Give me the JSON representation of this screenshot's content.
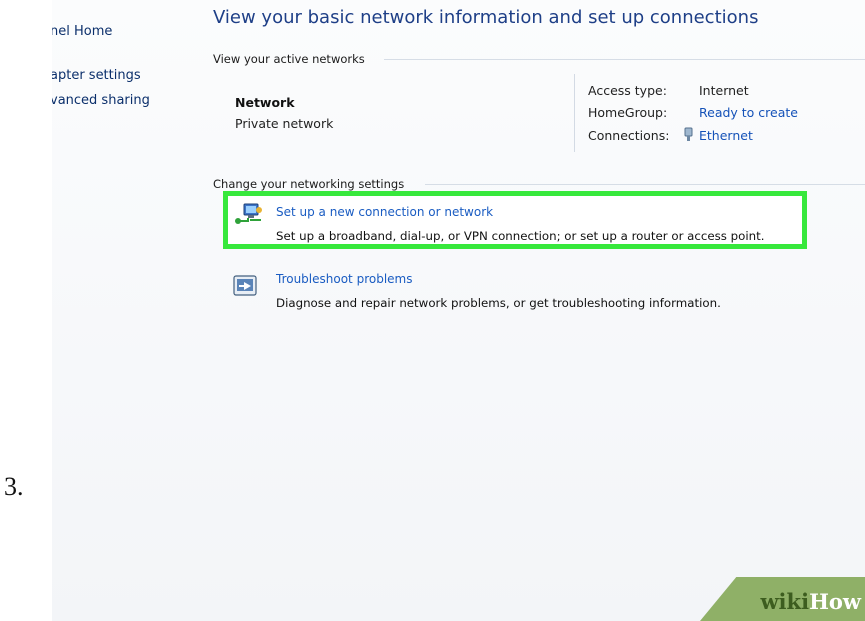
{
  "step_number": "3.",
  "sidebar": {
    "items": [
      {
        "label": "nel Home"
      },
      {
        "label": "apter settings"
      },
      {
        "label": "vanced sharing"
      }
    ]
  },
  "main": {
    "title": "View your basic network information and set up connections",
    "active_networks": {
      "label": "View your active networks",
      "network_name": "Network",
      "network_type": "Private network",
      "access_type_label": "Access type:",
      "access_type_value": "Internet",
      "homegroup_label": "HomeGroup:",
      "homegroup_value": "Ready to create",
      "connections_label": "Connections:",
      "connections_value": "Ethernet"
    },
    "change_settings": {
      "label": "Change your networking settings",
      "tasks": [
        {
          "link": "Set up a new connection or network",
          "description": "Set up a broadband, dial-up, or VPN connection; or set up a router or access point.",
          "icon": "network-setup-icon"
        },
        {
          "link": "Troubleshoot problems",
          "description": "Diagnose and repair network problems, or get troubleshooting information.",
          "icon": "troubleshoot-icon"
        }
      ]
    }
  },
  "watermark": {
    "wiki": "wiki",
    "how": "How"
  },
  "colors": {
    "highlight": "#37e83c",
    "link": "#1a5cc2",
    "title": "#1e3f87"
  }
}
